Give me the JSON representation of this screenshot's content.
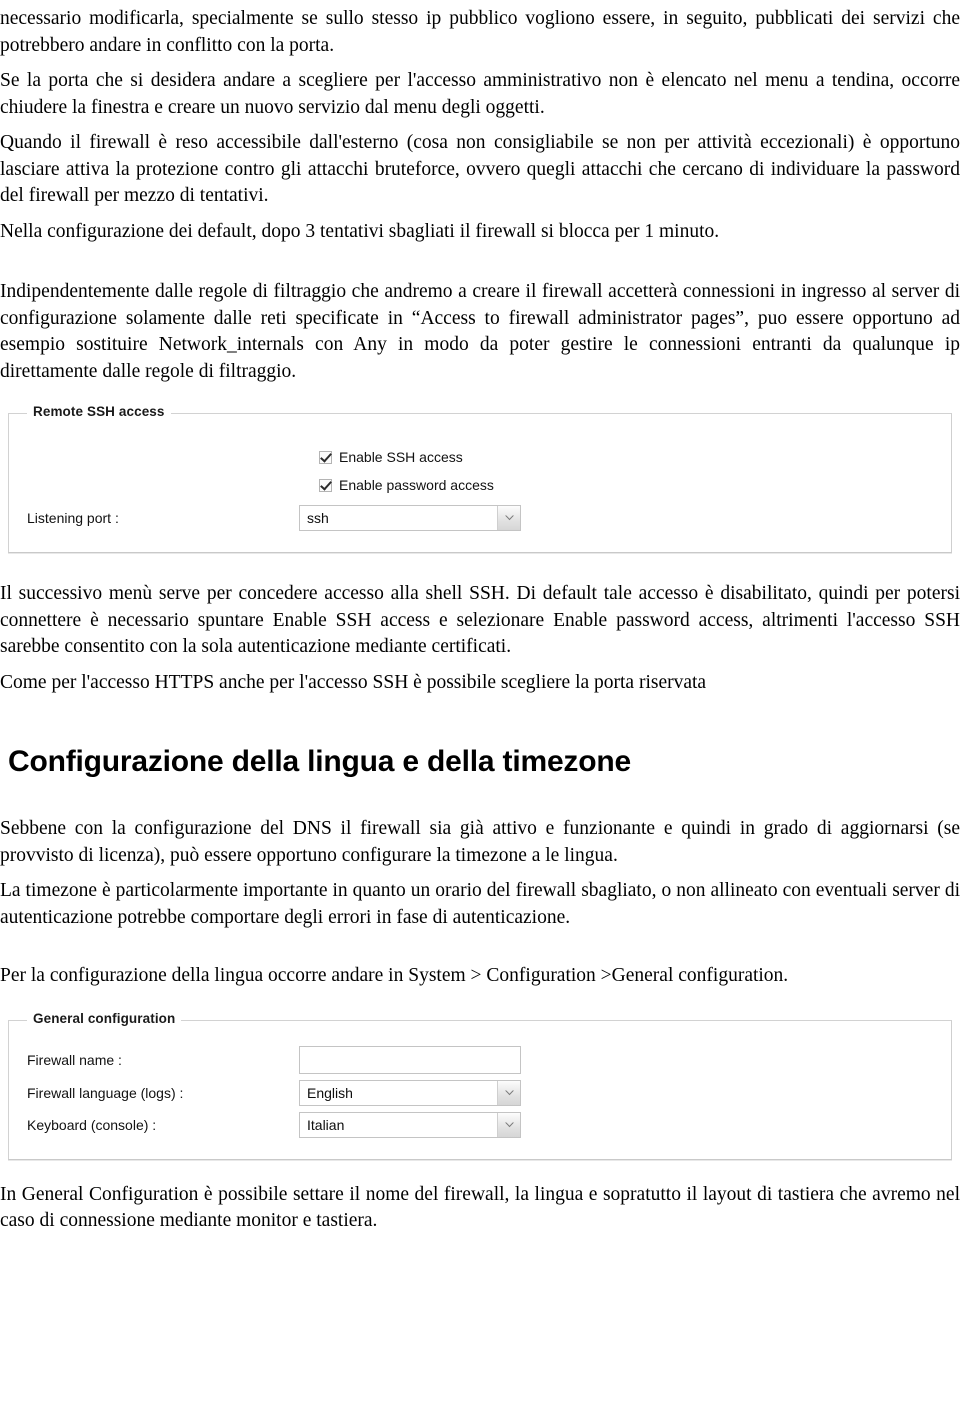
{
  "document": {
    "paragraphs": {
      "p1": "necessario modificarla, specialmente se sullo stesso ip pubblico vogliono essere, in seguito, pubblicati dei servizi che potrebbero andare in conflitto con la porta.",
      "p2": "Se la porta che si desidera andare a scegliere per l'accesso amministrativo non è elencato nel menu a tendina, occorre chiudere la finestra e creare un nuovo servizio dal menu degli oggetti.",
      "p3": "Quando il firewall è reso accessibile dall'esterno (cosa non consigliabile se non per attività eccezionali) è opportuno lasciare attiva la protezione contro gli attacchi bruteforce, ovvero quegli attacchi che cercano di individuare la password del firewall per mezzo di tentativi.",
      "p4": "Nella configurazione dei default, dopo 3 tentativi sbagliati il firewall si blocca per 1 minuto.",
      "p5": "Indipendentemente dalle regole di filtraggio che andremo a creare il firewall accetterà connessioni in ingresso al server di configurazione solamente dalle reti specificate in “Access to firewall administrator pages”, puo essere opportuno ad esempio sostituire Network_internals con Any in modo da poter gestire le connessioni entranti da qualunque ip direttamente dalle regole di filtraggio.",
      "p6": "Il successivo menù serve per concedere accesso alla shell SSH. Di default tale accesso è disabilitato, quindi per potersi connettere è necessario spuntare Enable SSH access e selezionare Enable password access, altrimenti l'accesso SSH sarebbe consentito con la sola autenticazione mediante certificati.",
      "p7": "Come per l'accesso HTTPS anche per l'accesso SSH è possibile scegliere la porta riservata",
      "p8": "Sebbene con la configurazione del DNS il firewall sia già attivo e funzionante e quindi in grado di aggiornarsi (se provvisto di licenza), può essere opportuno configurare la timezone a le lingua.",
      "p9": "La timezone è particolarmente importante in quanto un orario del firewall sbagliato, o non allineato con eventuali server di autenticazione potrebbe comportare degli errori in fase di autenticazione.",
      "p10": "Per la configurazione della lingua occorre andare in System > Configuration >General configuration.",
      "p11": "In General Configuration è possibile settare il nome del firewall, la lingua e sopratutto il layout di tastiera che avremo nel caso di connessione mediante monitor e tastiera."
    },
    "heading1": "Configurazione della lingua e della timezone"
  },
  "ssh_panel": {
    "legend": "Remote SSH access",
    "enable_ssh_label": "Enable SSH access",
    "enable_ssh_checked": true,
    "enable_password_label": "Enable password access",
    "enable_password_checked": true,
    "listening_port_label": "Listening port :",
    "listening_port_value": "ssh"
  },
  "general_panel": {
    "legend": "General configuration",
    "firewall_name_label": "Firewall name :",
    "firewall_name_value": "",
    "firewall_language_label": "Firewall language (logs) :",
    "firewall_language_value": "English",
    "keyboard_label": "Keyboard (console) :",
    "keyboard_value": "Italian"
  },
  "colors": {
    "panel_border": "#d2d2d2",
    "control_border": "#c4c4c4",
    "text": "#000000",
    "legend_text": "#1a1a1a"
  }
}
